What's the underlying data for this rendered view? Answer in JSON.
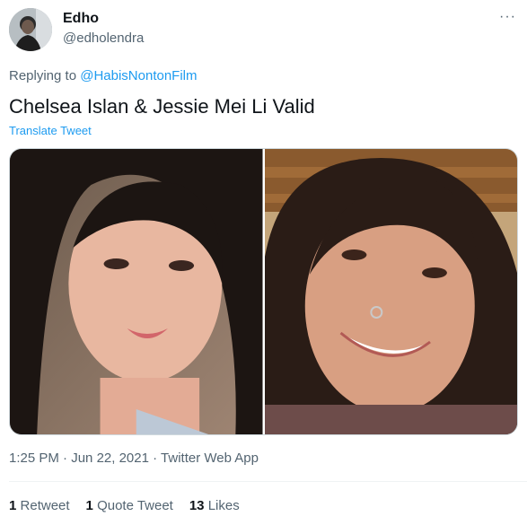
{
  "author": {
    "display_name": "Edho",
    "handle": "@edholendra"
  },
  "more_icon": "more-horizontal-icon",
  "reply": {
    "prefix": "Replying to",
    "mention": "@HabisNontonFilm"
  },
  "tweet": {
    "text": "Chelsea Islan & Jessie Mei Li Valid",
    "translate_label": "Translate Tweet"
  },
  "meta": {
    "time": "1:25 PM",
    "date": "Jun 22, 2021",
    "source": "Twitter Web App",
    "separator": "·"
  },
  "stats": {
    "retweets_count": "1",
    "retweets_label": "Retweet",
    "quote_count": "1",
    "quote_label": "Quote Tweet",
    "likes_count": "13",
    "likes_label": "Likes"
  },
  "colors": {
    "link": "#1d9bf0",
    "secondary_text": "#536471",
    "primary_text": "#0f1419"
  }
}
